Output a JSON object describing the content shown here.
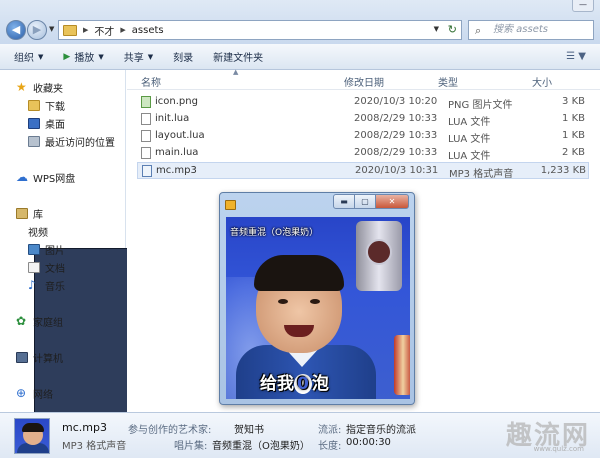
{
  "window": {
    "minimize_glyph": "—"
  },
  "address": {
    "crumbs": [
      "不才",
      "assets"
    ],
    "search_placeholder": "搜索 assets"
  },
  "toolbar": {
    "organize": "组织",
    "play": "播放",
    "share": "共享",
    "burn": "刻录",
    "new_folder": "新建文件夹"
  },
  "nav": {
    "favorites": "收藏夹",
    "downloads": "下载",
    "desktop": "桌面",
    "recent": "最近访问的位置",
    "wps_cloud": "WPS网盘",
    "libraries": "库",
    "videos": "视频",
    "pictures": "图片",
    "documents": "文档",
    "music": "音乐",
    "homegroup": "家庭组",
    "computer": "计算机",
    "network": "网络"
  },
  "columns": {
    "name": "名称",
    "date": "修改日期",
    "type": "类型",
    "size": "大小"
  },
  "files": [
    {
      "name": "icon.png",
      "date": "2020/10/3 10:20",
      "type": "PNG 图片文件",
      "size": "3 KB",
      "icon": "png-file-icon"
    },
    {
      "name": "init.lua",
      "date": "2008/2/29 10:33",
      "type": "LUA 文件",
      "size": "1 KB",
      "icon": "lua-file-icon"
    },
    {
      "name": "layout.lua",
      "date": "2008/2/29 10:33",
      "type": "LUA 文件",
      "size": "1 KB",
      "icon": "lua-file-icon"
    },
    {
      "name": "main.lua",
      "date": "2008/2/29 10:33",
      "type": "LUA 文件",
      "size": "2 KB",
      "icon": "lua-file-icon"
    },
    {
      "name": "mc.mp3",
      "date": "2020/10/3 10:31",
      "type": "MP3 格式声音",
      "size": "1,233 KB",
      "icon": "mp3-file-icon",
      "selected": true
    }
  ],
  "player": {
    "video_title": "音频重混（O泡果奶）",
    "subtitle_pre": "给我",
    "subtitle_zero": "0",
    "subtitle_post": "泡"
  },
  "details": {
    "name": "mc.mp3",
    "type": "MP3 格式声音",
    "artist_label": "参与创作的艺术家:",
    "artist": "贺知书",
    "album_label": "唱片集:",
    "album": "音频重混（O泡果奶）",
    "genre_label": "流派:",
    "genre": "指定音乐的流派",
    "length_label": "长度:",
    "length": "00:00:30"
  },
  "watermark": {
    "text": "趣流网",
    "url": "www.qulz.com"
  },
  "colors": {
    "accent": "#3b6fc4",
    "selection": "#e6eef9"
  }
}
